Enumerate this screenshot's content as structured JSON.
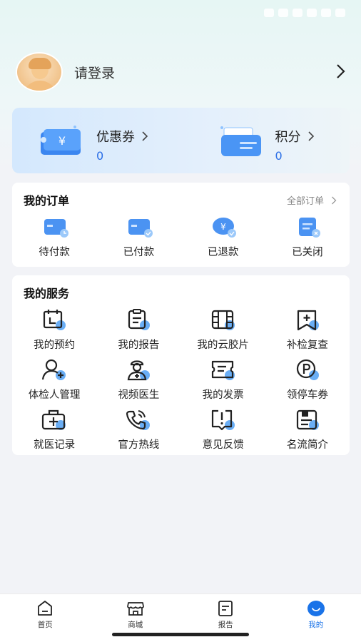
{
  "profile": {
    "login_text": "请登录"
  },
  "wallet": [
    {
      "title": "优惠券",
      "value": "0",
      "icon": "coupon-ticket-icon"
    },
    {
      "title": "积分",
      "value": "0",
      "icon": "points-wallet-icon"
    }
  ],
  "orders": {
    "title": "我的订单",
    "more": "全部订单",
    "items": [
      {
        "label": "待付款",
        "icon": "pending-payment-card-icon"
      },
      {
        "label": "已付款",
        "icon": "paid-card-icon"
      },
      {
        "label": "已退款",
        "icon": "refunded-coin-icon"
      },
      {
        "label": "已关闭",
        "icon": "closed-order-icon"
      }
    ]
  },
  "services": {
    "title": "我的服务",
    "items": [
      {
        "label": "我的预约",
        "icon": "calendar-icon"
      },
      {
        "label": "我的报告",
        "icon": "clipboard-report-icon"
      },
      {
        "label": "我的云胶片",
        "icon": "film-icon"
      },
      {
        "label": "补检复查",
        "icon": "recheck-plus-icon"
      },
      {
        "label": "体检人管理",
        "icon": "person-add-icon"
      },
      {
        "label": "视频医生",
        "icon": "doctor-icon"
      },
      {
        "label": "我的发票",
        "icon": "invoice-icon"
      },
      {
        "label": "领停车券",
        "icon": "parking-icon"
      },
      {
        "label": "就医记录",
        "icon": "medical-kit-icon"
      },
      {
        "label": "官方热线",
        "icon": "phone-icon"
      },
      {
        "label": "意见反馈",
        "icon": "feedback-icon"
      },
      {
        "label": "名流简介",
        "icon": "intro-document-icon"
      }
    ]
  },
  "tabbar": [
    {
      "label": "首页",
      "icon": "home-icon",
      "active": false
    },
    {
      "label": "商城",
      "icon": "shop-icon",
      "active": false
    },
    {
      "label": "报告",
      "icon": "report-icon",
      "active": false
    },
    {
      "label": "我的",
      "icon": "profile-smile-icon",
      "active": true
    }
  ],
  "colors": {
    "accent": "#1a73e8",
    "value_blue": "#2a6ee6",
    "icon_dot": "#6aaef5"
  }
}
